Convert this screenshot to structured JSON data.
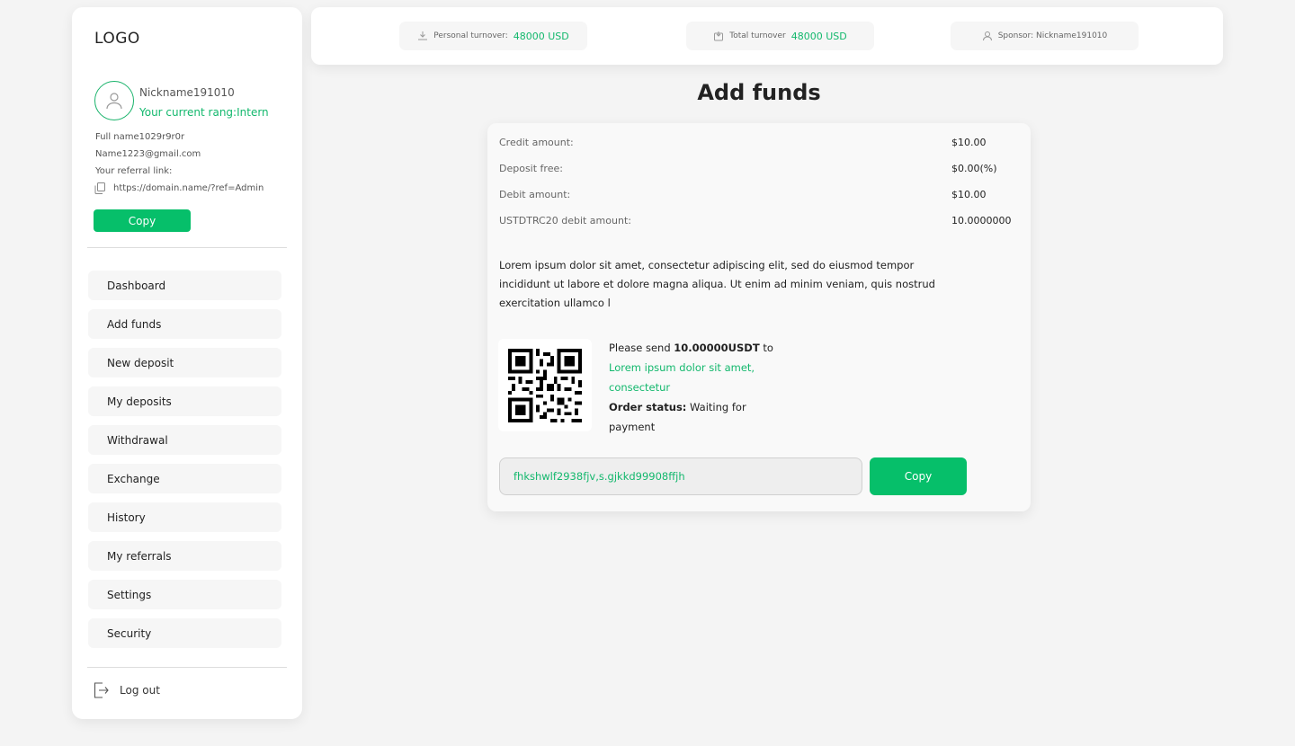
{
  "colors": {
    "accent": "#06bf6a",
    "accent_text": "#13b86d",
    "background": "#f4f4f4"
  },
  "sidebar": {
    "logo": "LOGO",
    "avatar_icon": "user-icon",
    "nickname": "Nickname191010",
    "rang": "Your current rang:Intern",
    "full_name": "Full name1029r9r0r",
    "email": "Name1223@gmail.com",
    "referral_label": "Your referral link:",
    "referral_link": "https://domain.name/?ref=Admin",
    "copy_label": "Copy",
    "nav": [
      {
        "label": "Dashboard"
      },
      {
        "label": "Add funds"
      },
      {
        "label": "New deposit"
      },
      {
        "label": "My deposits"
      },
      {
        "label": "Withdrawal"
      },
      {
        "label": "Exchange"
      },
      {
        "label": "History"
      },
      {
        "label": "My referrals"
      },
      {
        "label": "Settings"
      },
      {
        "label": "Security"
      }
    ],
    "logout_label": "Log out"
  },
  "topbar": {
    "personal_label": "Personal turnover:",
    "personal_value": "48000 USD",
    "total_label": "Total turnover",
    "total_value": "48000 USD",
    "sponsor_label": "Sponsor: Nickname191010"
  },
  "main": {
    "title": "Add funds",
    "rows": [
      {
        "label": "Credit amount:",
        "value": "$10.00"
      },
      {
        "label": "Deposit free:",
        "value": "$0.00(%)"
      },
      {
        "label": "Debit amount:",
        "value": "$10.00"
      },
      {
        "label": "USTDTRC20 debit amount:",
        "value": "10.0000000"
      }
    ],
    "description": "Lorem ipsum dolor sit amet, consectetur adipiscing elit, sed do eiusmod tempor incididunt ut labore et dolore magna aliqua. Ut enim ad minim veniam, quis nostrud exercitation ullamco l",
    "send_prefix": "Please send",
    "send_amount": "10.00000USDT",
    "send_suffix": "to",
    "send_address": "Lorem ipsum dolor sit amet, consectetur",
    "status_label": "Order status:",
    "status_value": "Waiting for payment",
    "address_value": "fhkshwlf2938fjv,s.gjkkd99908ffjh",
    "copy_label": "Copy"
  }
}
